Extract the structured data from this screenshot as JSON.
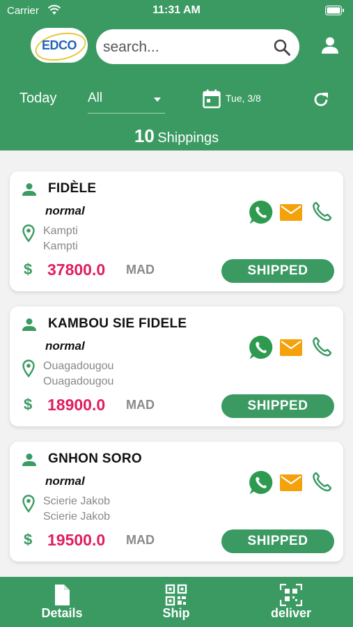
{
  "status_bar": {
    "carrier": "Carrier",
    "time": "11:31 AM"
  },
  "header": {
    "logo_text": "EDCO",
    "search_placeholder": "search...",
    "today_label": "Today",
    "filter_value": "All",
    "date": "Tue, 3/8",
    "shipping_count": "10",
    "shipping_label": "Shippings"
  },
  "colors": {
    "primary": "#3a9a62",
    "amount": "#e01f5d",
    "mail": "#f5a10a",
    "whatsapp": "#2e9a4f"
  },
  "shipments": [
    {
      "name": "FIDÈLE",
      "type": "normal",
      "address_line1": "Kampti",
      "address_line2": "Kampti",
      "amount": "37800.0",
      "currency": "MAD",
      "status": "SHIPPED"
    },
    {
      "name": "KAMBOU SIE FIDELE",
      "type": "normal",
      "address_line1": "Ouagadougou",
      "address_line2": "Ouagadougou",
      "amount": "18900.0",
      "currency": "MAD",
      "status": "SHIPPED"
    },
    {
      "name": "GNHON SORO",
      "type": "normal",
      "address_line1": "Scierie Jakob",
      "address_line2": "Scierie Jakob",
      "amount": "19500.0",
      "currency": "MAD",
      "status": "SHIPPED"
    }
  ],
  "tabs": [
    {
      "label": "Details",
      "icon": "document-icon"
    },
    {
      "label": "Ship",
      "icon": "qr-code-icon"
    },
    {
      "label": "deliver",
      "icon": "qr-scan-icon"
    }
  ]
}
